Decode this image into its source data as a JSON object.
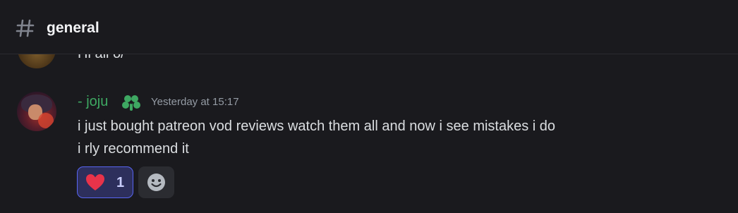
{
  "header": {
    "icon": "hash-icon",
    "channel_name": "general"
  },
  "previous_message": {
    "text": "Hi all o/"
  },
  "message": {
    "username": "- joju",
    "username_color": "#3ea862",
    "role_icon": "clover-icon",
    "timestamp": "Yesterday at 15:17",
    "lines": [
      "i just bought patreon vod reviews watch them all and now i see mistakes i do",
      "i rly recommend it"
    ],
    "reactions": [
      {
        "emoji": "heart-icon",
        "count": "1",
        "active": true
      }
    ],
    "add_reaction_icon": "smile-icon"
  },
  "colors": {
    "background": "#1a1a1e",
    "accent": "#5865f2",
    "reaction_bg": "#2d2f5c",
    "heart": "#e8334a"
  }
}
